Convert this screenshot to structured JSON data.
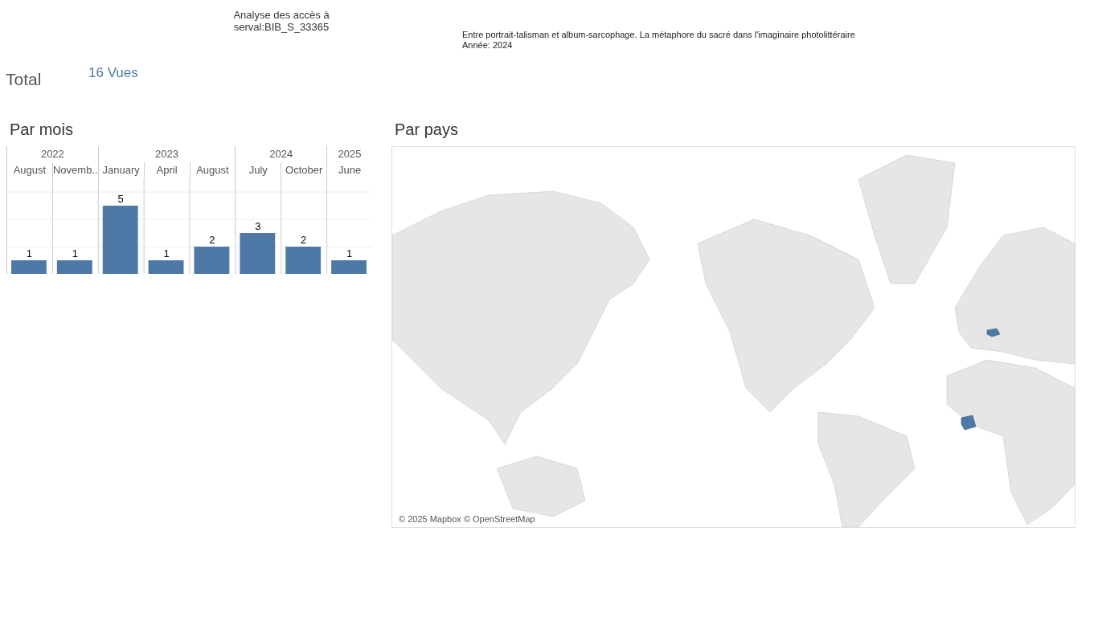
{
  "header": {
    "title": "Analyse des accès à",
    "identifier": "serval:BIB_S_33365",
    "document_title": "Entre portrait-talisman et album-sarcophage. La métaphore du sacré dans l'imaginaire photolittéraire",
    "year_line": "Année: 2024"
  },
  "total": {
    "label": "Total",
    "value": "16 Vues"
  },
  "monthly": {
    "title": "Par mois",
    "years": [
      {
        "label": "2022",
        "span": "2"
      },
      {
        "label": "2023",
        "span": "3"
      },
      {
        "label": "2024",
        "span": "2"
      },
      {
        "label": "2025",
        "span": "1"
      }
    ],
    "chart_data": {
      "type": "bar",
      "categories": [
        "August",
        "Novemb..",
        "January",
        "April",
        "August",
        "July",
        "October",
        "June"
      ],
      "values": [
        1,
        1,
        5,
        1,
        2,
        3,
        2,
        1
      ],
      "ylim": [
        0,
        7
      ],
      "data_labels": true
    }
  },
  "country": {
    "title": "Par pays",
    "attribution": "© 2025 Mapbox © OpenStreetMap"
  }
}
